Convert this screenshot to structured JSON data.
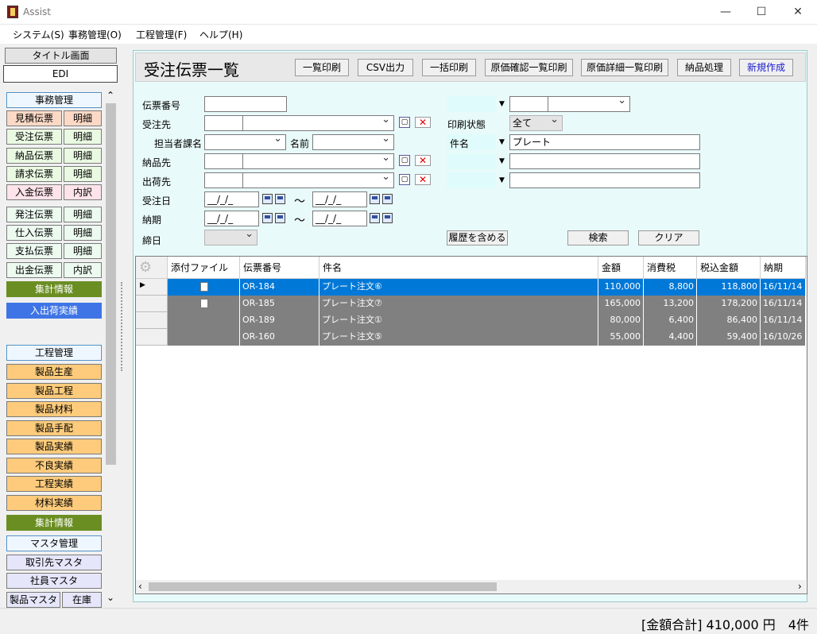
{
  "window": {
    "title": "Assist",
    "minimize": "—",
    "maximize": "☐",
    "close": "✕"
  },
  "menu": [
    "システム(S)",
    "事務管理(O)",
    "工程管理(F)",
    "ヘルプ(H)"
  ],
  "nav": {
    "title_screen": "タイトル画面",
    "edi": "EDI",
    "office_header": "事務管理",
    "rows": [
      [
        "見積伝票",
        "明細"
      ],
      [
        "受注伝票",
        "明細"
      ],
      [
        "納品伝票",
        "明細"
      ],
      [
        "請求伝票",
        "明細"
      ],
      [
        "入金伝票",
        "内訳"
      ],
      [
        "発注伝票",
        "明細"
      ],
      [
        "仕入伝票",
        "明細"
      ],
      [
        "支払伝票",
        "明細"
      ],
      [
        "出金伝票",
        "内訳"
      ]
    ],
    "summary1": "集計情報",
    "shipping": "入出荷実績",
    "process_header": "工程管理",
    "process_items": [
      "製品生産",
      "製品工程",
      "製品材料",
      "製品手配",
      "製品実績",
      "不良実績",
      "工程実績",
      "材料実績"
    ],
    "summary2": "集計情報",
    "master_header": "マスタ管理",
    "master_items": [
      "取引先マスタ",
      "社員マスタ"
    ],
    "product_master": "製品マスタ",
    "stock": "在庫",
    "scroll_up": "⌃",
    "scroll_down": "⌄"
  },
  "page": {
    "title": "受注伝票一覧",
    "toolbar": [
      "一覧印刷",
      "CSV出力",
      "一括印刷",
      "原価確認一覧印刷",
      "原価詳細一覧印刷",
      "納品処理",
      "新規作成"
    ]
  },
  "form": {
    "slip_no": "伝票番号",
    "customer": "受注先",
    "dept": "担当者課名",
    "name": "名前",
    "delivery_to": "納品先",
    "ship_to": "出荷先",
    "order_date": "受注日",
    "due_date": "納期",
    "closing": "締日",
    "date_mask": "__/_/_",
    "tilde": "～",
    "print_status": "印刷状態",
    "print_status_value": "全て",
    "subject": "件名",
    "subject_value": "プレート",
    "include_history": "履歴を含める",
    "search": "検索",
    "clear": "クリア"
  },
  "grid": {
    "columns": [
      "添付ファイル",
      "伝票番号",
      "件名",
      "金額",
      "消費税",
      "税込金額",
      "納期"
    ],
    "rows": [
      {
        "attach": true,
        "no": "OR-184",
        "subject": "プレート注文⑥",
        "amount": "110,000",
        "tax": "8,800",
        "total": "118,800",
        "due": "16/11/14",
        "selected": true
      },
      {
        "attach": true,
        "no": "OR-185",
        "subject": "プレート注文⑦",
        "amount": "165,000",
        "tax": "13,200",
        "total": "178,200",
        "due": "16/11/14",
        "selected": false
      },
      {
        "attach": false,
        "no": "OR-189",
        "subject": "プレート注文①",
        "amount": "80,000",
        "tax": "6,400",
        "total": "86,400",
        "due": "16/11/14",
        "selected": false
      },
      {
        "attach": false,
        "no": "OR-160",
        "subject": "プレート注文⑤",
        "amount": "55,000",
        "tax": "4,400",
        "total": "59,400",
        "due": "16/10/26",
        "selected": false
      }
    ]
  },
  "status": "[金額合計] 410,000 円　4件",
  "colors": {
    "selected_row": "#0078d7",
    "row": "#808080"
  }
}
